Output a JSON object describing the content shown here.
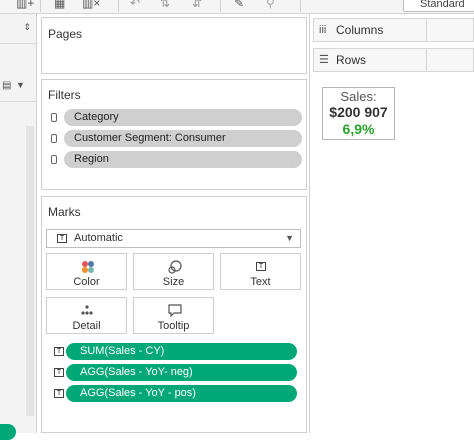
{
  "toolbar": {
    "icons": [
      "add-sheet-icon",
      "clear-icon",
      "clear-sheet-icon",
      "undo-icon",
      "swap-icon",
      "highlight-icon",
      "pin-icon"
    ],
    "fit_value": "Standard"
  },
  "pages": {
    "title": "Pages"
  },
  "filters": {
    "title": "Filters",
    "items": [
      "Category",
      "Customer Segment: Consumer",
      "Region"
    ]
  },
  "marks": {
    "title": "Marks",
    "mark_type": "Automatic",
    "buttons": [
      "Color",
      "Size",
      "Text",
      "Detail",
      "Tooltip"
    ],
    "pills": [
      "SUM(Sales - CY)",
      "AGG(Sales - YoY- neg)",
      "AGG(Sales - YoY - pos)"
    ],
    "pill_color": "#00a777"
  },
  "shelves": {
    "columns": "Columns",
    "rows": "Rows"
  },
  "kpi": {
    "label": "Sales:",
    "value": "$200 907",
    "change": "6,9%",
    "change_color": "#2ca02c"
  }
}
